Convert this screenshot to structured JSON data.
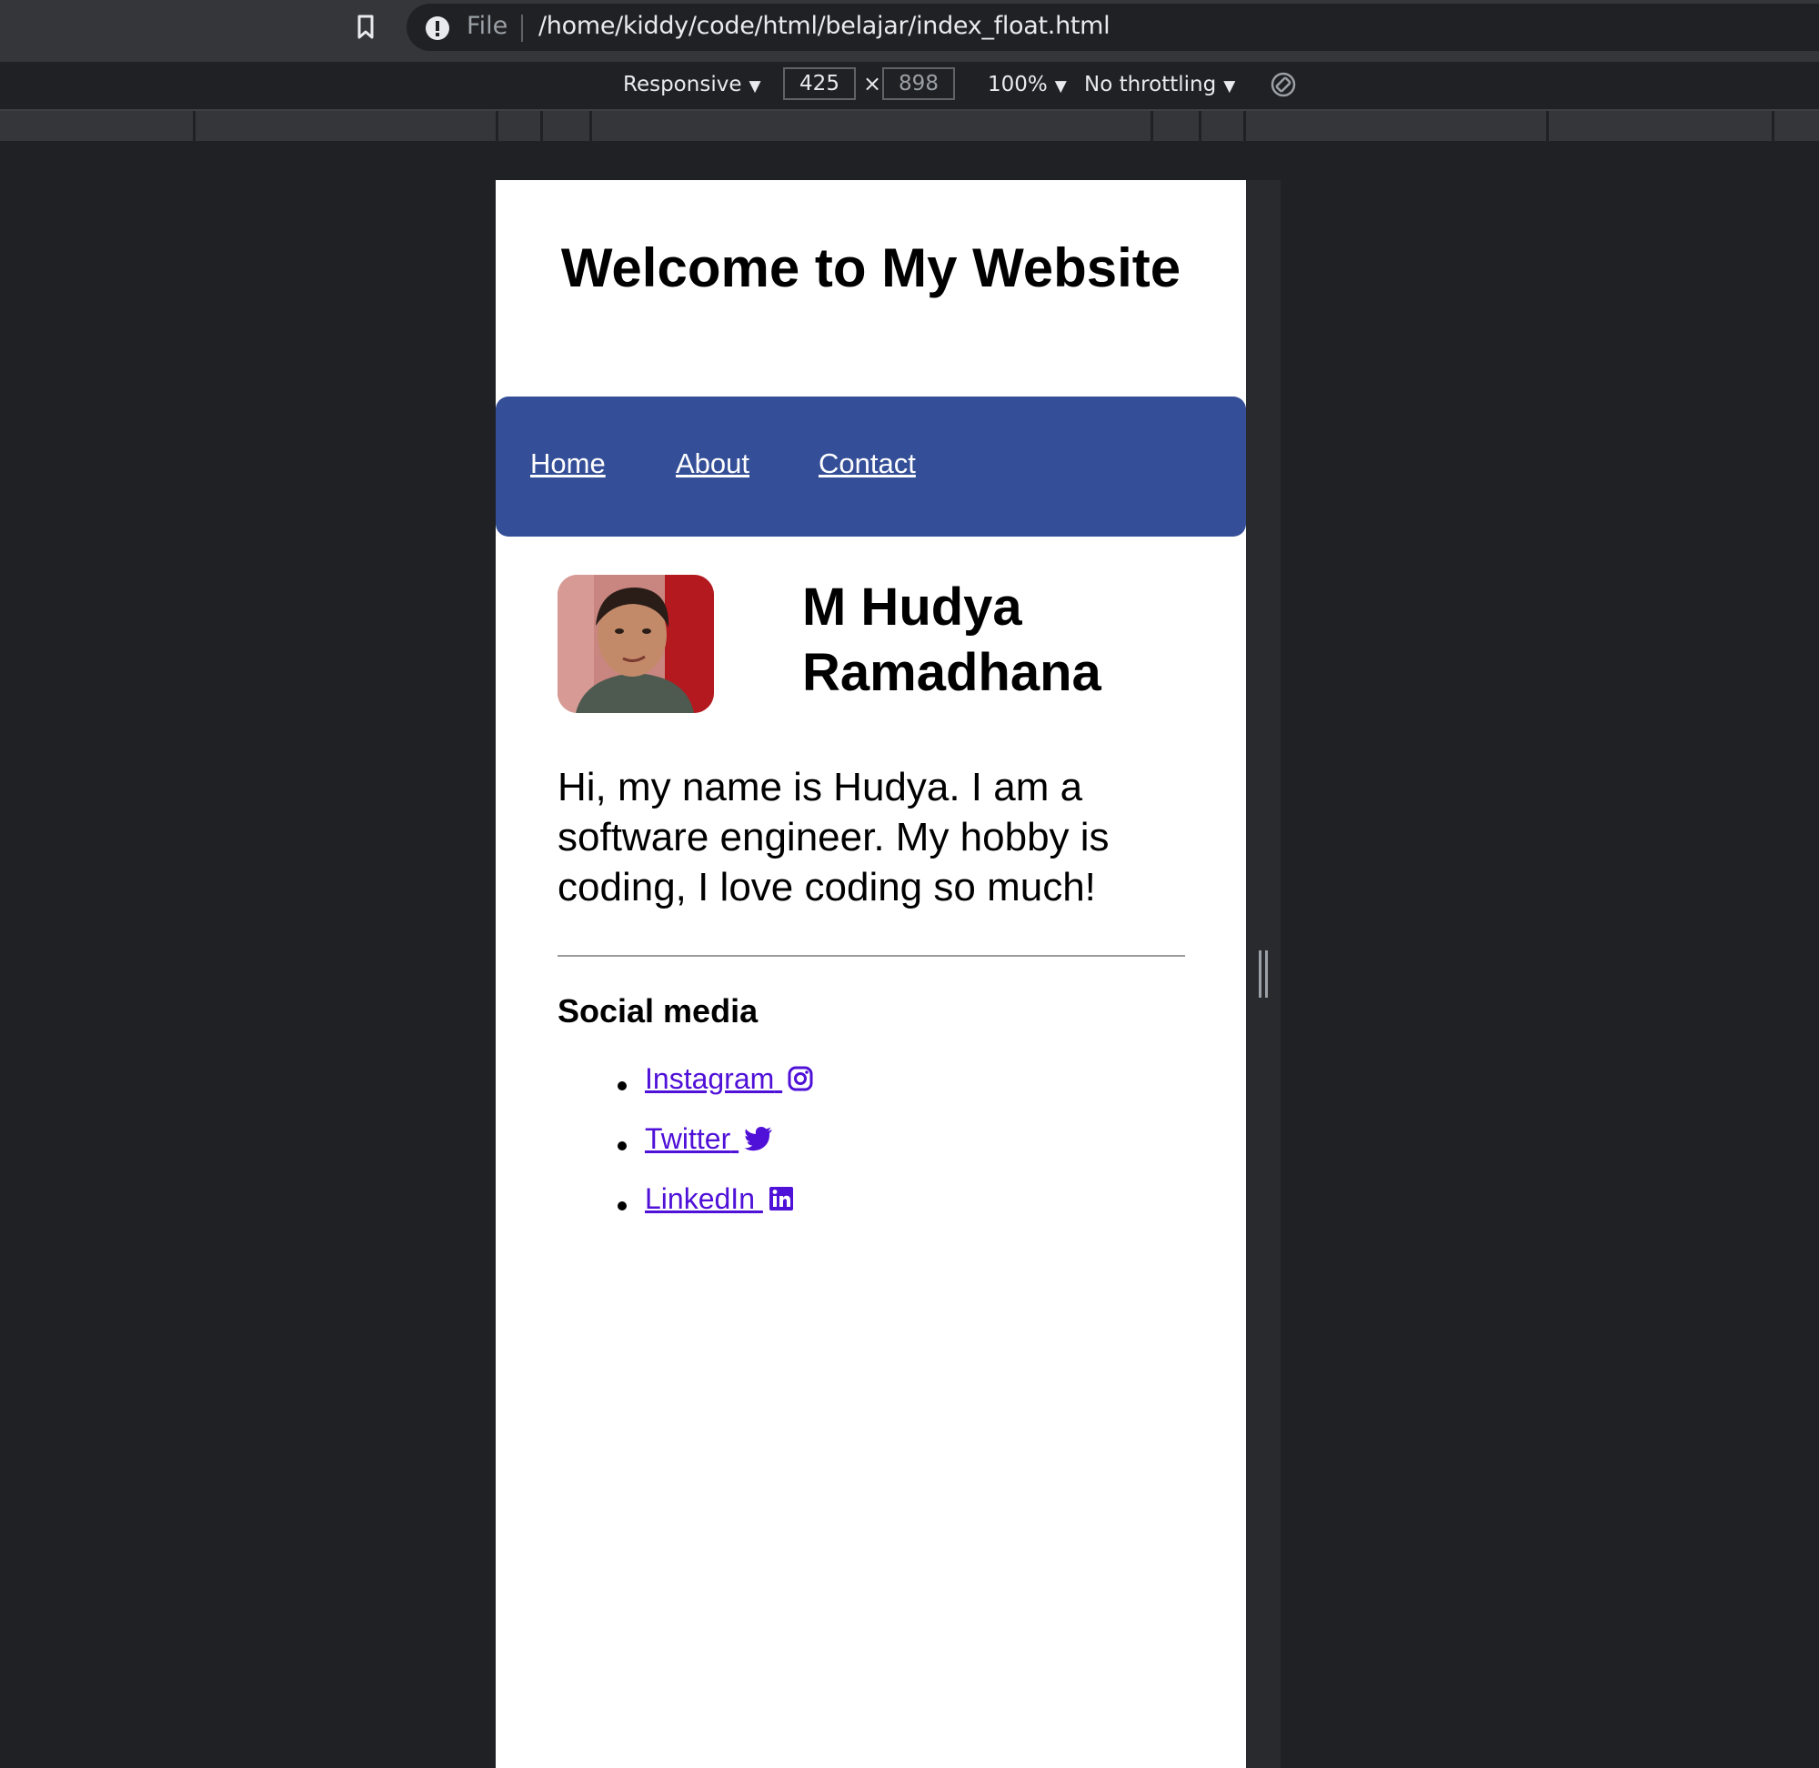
{
  "browser": {
    "file_label": "File",
    "url": "/home/kiddy/code/html/belajar/index_float.html"
  },
  "devtools": {
    "device": "Responsive",
    "width": "425",
    "height": "898",
    "zoom": "100%",
    "throttling": "No throttling",
    "times": "×"
  },
  "page": {
    "title": "Welcome to My Website",
    "nav": [
      {
        "label": "Home"
      },
      {
        "label": "About"
      },
      {
        "label": "Contact"
      }
    ],
    "profile": {
      "name": "M Hudya Ramadhana",
      "bio": "Hi, my name is Hudya. I am a software engineer. My hobby is coding, I love coding so much!"
    },
    "social": {
      "heading": "Social media",
      "links": [
        {
          "label": "Instagram",
          "icon": "instagram-icon"
        },
        {
          "label": "Twitter",
          "icon": "twitter-icon"
        },
        {
          "label": "LinkedIn",
          "icon": "linkedin-icon"
        }
      ]
    }
  },
  "colors": {
    "nav_background": "#344e97",
    "link": "#4f10d8",
    "devtools_background": "#202124"
  }
}
